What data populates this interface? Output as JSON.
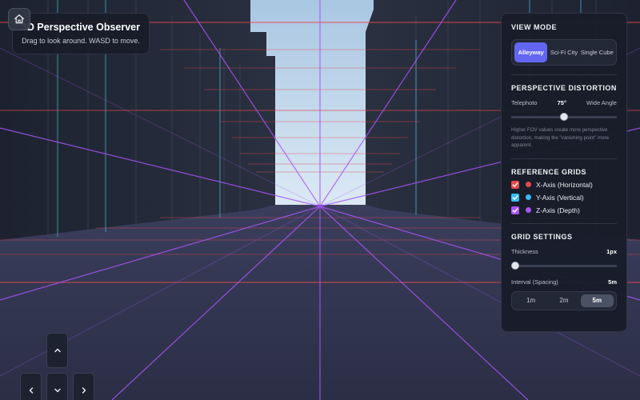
{
  "header": {
    "title": "3D Perspective Observer",
    "subtitle": "Drag to look around. WASD to move.",
    "home_icon": "home-icon"
  },
  "panel": {
    "view_mode": {
      "title": "VIEW MODE",
      "options": [
        "Alleyway",
        "Sci-Fi City",
        "Single Cube"
      ],
      "selected": "Alleyway"
    },
    "distortion": {
      "title": "PERSPECTIVE DISTORTION",
      "left_label": "Telephoto",
      "value_label": "75°",
      "right_label": "Wide Angle",
      "slider_fraction": 0.5,
      "note": "Higher FOV values create more perspective distortion, making the \"vanishing point\" more apparent."
    },
    "grids": {
      "title": "REFERENCE GRIDS",
      "items": [
        {
          "label": "X-Axis (Horizontal)",
          "checked": true,
          "color": "#e5484d"
        },
        {
          "label": "Y-Axis (Vertical)",
          "checked": true,
          "color": "#38bdf8"
        },
        {
          "label": "Z-Axis (Depth)",
          "checked": true,
          "color": "#a855f7"
        }
      ]
    },
    "settings": {
      "title": "GRID SETTINGS",
      "thickness_label": "Thickness",
      "thickness_value": "1px",
      "thickness_fraction": 0.0,
      "interval_label": "Interval (Spacing)",
      "interval_value": "5m",
      "interval_options": [
        "1m",
        "2m",
        "5m"
      ],
      "interval_selected": "5m"
    }
  },
  "controls": {
    "up_icon": "chevron-up-icon",
    "left_icon": "chevron-left-icon",
    "down_icon": "chevron-down-icon",
    "right_icon": "chevron-right-icon"
  },
  "colors": {
    "accent": "#6366f1",
    "grid_x": "#e5484d",
    "grid_y": "#38bdf8",
    "grid_z": "#a855f7",
    "sky_top": "#a9c6e2",
    "sky_bottom": "#dbe9f4"
  }
}
